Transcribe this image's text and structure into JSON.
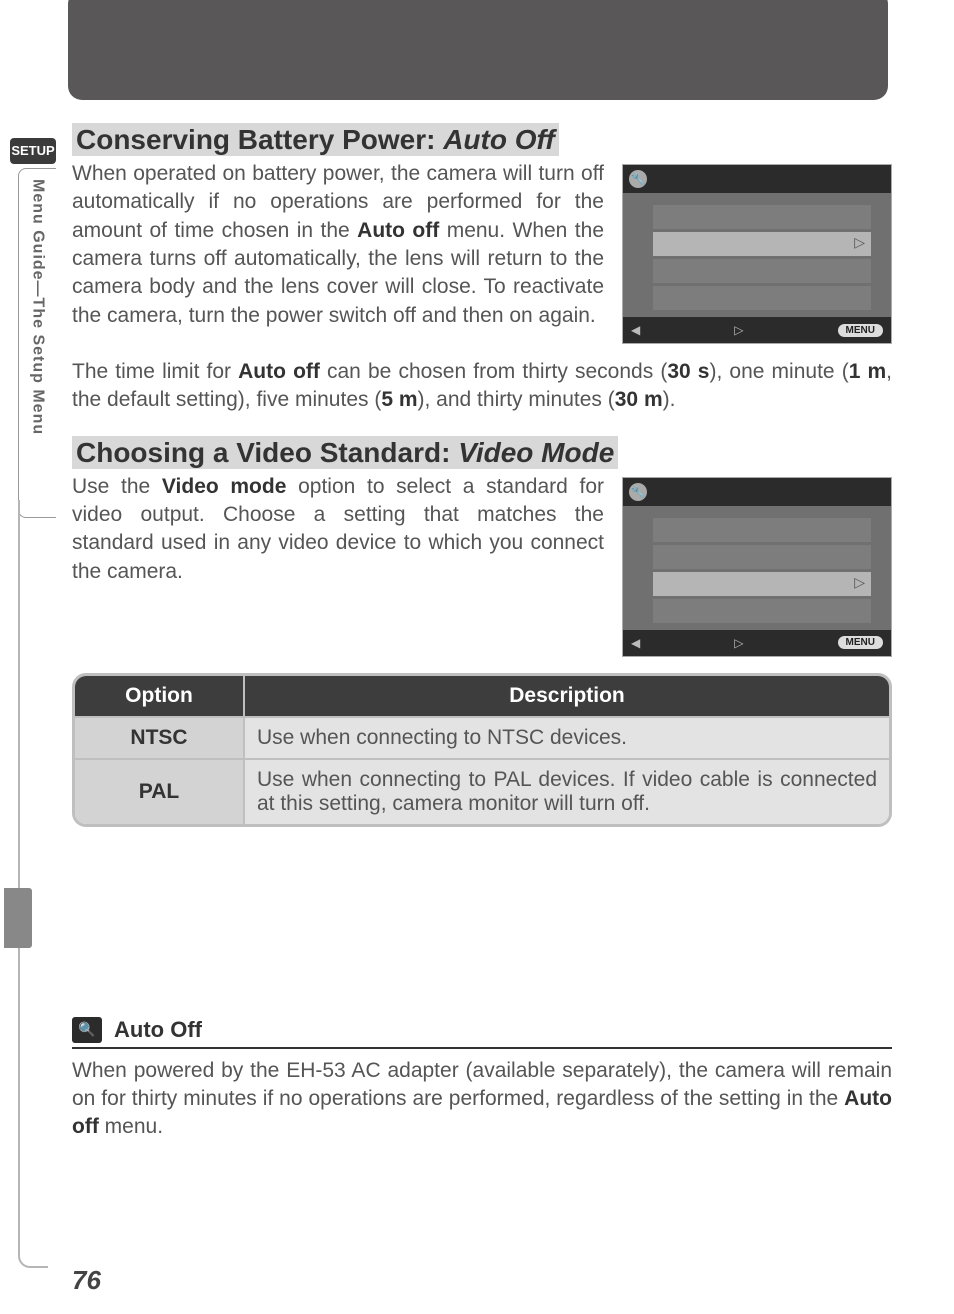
{
  "side": {
    "setup_badge": "SETUP",
    "vertical_label": "Menu Guide—The Setup Menu"
  },
  "heading1_prefix": "Conserving Battery Power: ",
  "heading1_em": "Auto Off",
  "para1_a": "When operated on battery power, the camera will turn off automatically if no operations are per­formed for the amount of time chosen in the ",
  "para1_b": "Auto off",
  "para1_c": " menu.  When the camera turns off automati­cally, the lens will return to the camera body and the lens cover will close.  To reactivate the cam­era, turn the power switch off and then on again.",
  "para2_a": "The time limit for ",
  "para2_b": "Auto off",
  "para2_c": " can be chosen from thirty seconds (",
  "para2_d": "30 s",
  "para2_e": "), one minute (",
  "para2_f": "1 m",
  "para2_g": ", the default setting), five minutes (",
  "para2_h": "5 m",
  "para2_i": "), and thirty minutes (",
  "para2_j": "30 m",
  "para2_k": ").",
  "heading2_prefix": "Choosing a Video Standard: ",
  "heading2_em": "Video Mode",
  "para3_a": "Use the ",
  "para3_b": "Video mode",
  "para3_c": " option to select a standard for video output.  Choose a setting that matches the standard used in any video device to which you connect the camera.",
  "table": {
    "h_option": "Option",
    "h_desc": "Description",
    "r1_opt": "NTSC",
    "r1_desc": "Use when connecting to NTSC devices.",
    "r2_opt": "PAL",
    "r2_desc": "Use when connecting to PAL devices.  If video cable is connected at this setting, camera monitor will turn off."
  },
  "note": {
    "title": "Auto Off",
    "body_a": "When powered by the EH-53 AC adapter (available separately), the camera will remain on for thirty minutes if no operations are performed, regardless of the setting in the ",
    "body_b": "Auto off",
    "body_c": " menu."
  },
  "lcd": {
    "menu_label": "MENU"
  },
  "page_number": "76"
}
